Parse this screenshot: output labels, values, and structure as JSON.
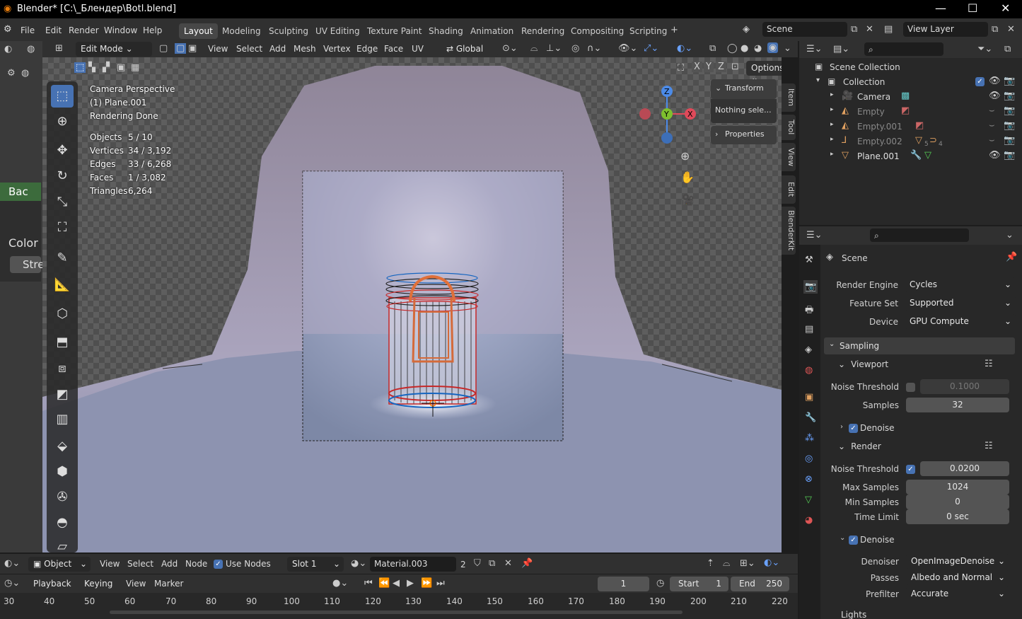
{
  "window": {
    "title": "Blender* [C:\\_Блендер\\Botl.blend]"
  },
  "menu": [
    "File",
    "Edit",
    "Render",
    "Window",
    "Help"
  ],
  "workspaces": [
    "Layout",
    "Modeling",
    "Sculpting",
    "UV Editing",
    "Texture Paint",
    "Shading",
    "Animation",
    "Rendering",
    "Compositing",
    "Scripting"
  ],
  "scene": {
    "name": "Scene",
    "view_layer": "View Layer"
  },
  "viewport_header": {
    "mode": "Edit Mode",
    "menus": [
      "View",
      "Select",
      "Add",
      "Mesh",
      "Vertex",
      "Edge",
      "Face",
      "UV"
    ],
    "orientation": "Global",
    "options": "Options"
  },
  "overlay": {
    "camera": "Camera Perspective",
    "object": "(1) Plane.001",
    "status": "Rendering Done",
    "stats": [
      {
        "label": "Objects",
        "value": "5 / 10"
      },
      {
        "label": "Vertices",
        "value": "34 / 3,192"
      },
      {
        "label": "Edges",
        "value": "33 / 6,268"
      },
      {
        "label": "Faces",
        "value": "1 / 3,082"
      },
      {
        "label": "Triangles",
        "value": "6,264"
      }
    ]
  },
  "npanel": {
    "transform": "Transform",
    "nothing": "Nothing sele...",
    "properties": "Properties",
    "tabs": [
      "Item",
      "Tool",
      "View",
      "Edit",
      "BlenderKit"
    ]
  },
  "left_editor": {
    "back": "Bac",
    "color": "Color",
    "stre": "Stre"
  },
  "outliner": {
    "root": "Scene Collection",
    "collection": "Collection",
    "items": [
      "Camera",
      "Empty",
      "Empty.001",
      "Empty.002",
      "Plane.001"
    ],
    "badge_5": "5",
    "badge_4": "4"
  },
  "properties": {
    "scene_label": "Scene",
    "render_engine": {
      "label": "Render Engine",
      "value": "Cycles"
    },
    "feature_set": {
      "label": "Feature Set",
      "value": "Supported"
    },
    "device": {
      "label": "Device",
      "value": "GPU Compute"
    },
    "sampling": "Sampling",
    "viewport": "Viewport",
    "vp_noise": {
      "label": "Noise Threshold",
      "value": "0.1000"
    },
    "vp_samples": {
      "label": "Samples",
      "value": "32"
    },
    "vp_denoise": "Denoise",
    "render": "Render",
    "r_noise": {
      "label": "Noise Threshold",
      "value": "0.0200"
    },
    "max_samples": {
      "label": "Max Samples",
      "value": "1024"
    },
    "min_samples": {
      "label": "Min Samples",
      "value": "0"
    },
    "time_limit": {
      "label": "Time Limit",
      "value": "0 sec"
    },
    "r_denoise": "Denoise",
    "denoiser": {
      "label": "Denoiser",
      "value": "OpenImageDenoise"
    },
    "passes": {
      "label": "Passes",
      "value": "Albedo and Normal"
    },
    "prefilter": {
      "label": "Prefilter",
      "value": "Accurate"
    },
    "lights": "Lights"
  },
  "shader_header": {
    "object": "Object",
    "menus": [
      "View",
      "Select",
      "Add",
      "Node"
    ],
    "use_nodes": "Use Nodes",
    "slot": "Slot 1",
    "material": "Material.003",
    "users": "2"
  },
  "timeline": {
    "menus": [
      "Playback",
      "Keying",
      "View",
      "Marker"
    ],
    "current": "1",
    "start_label": "Start",
    "start": "1",
    "end_label": "End",
    "end": "250"
  },
  "ruler": [
    "30",
    "40",
    "50",
    "60",
    "70",
    "80",
    "90",
    "100",
    "110",
    "120",
    "130",
    "140",
    "150",
    "160",
    "170",
    "180",
    "190",
    "200",
    "210",
    "220"
  ]
}
